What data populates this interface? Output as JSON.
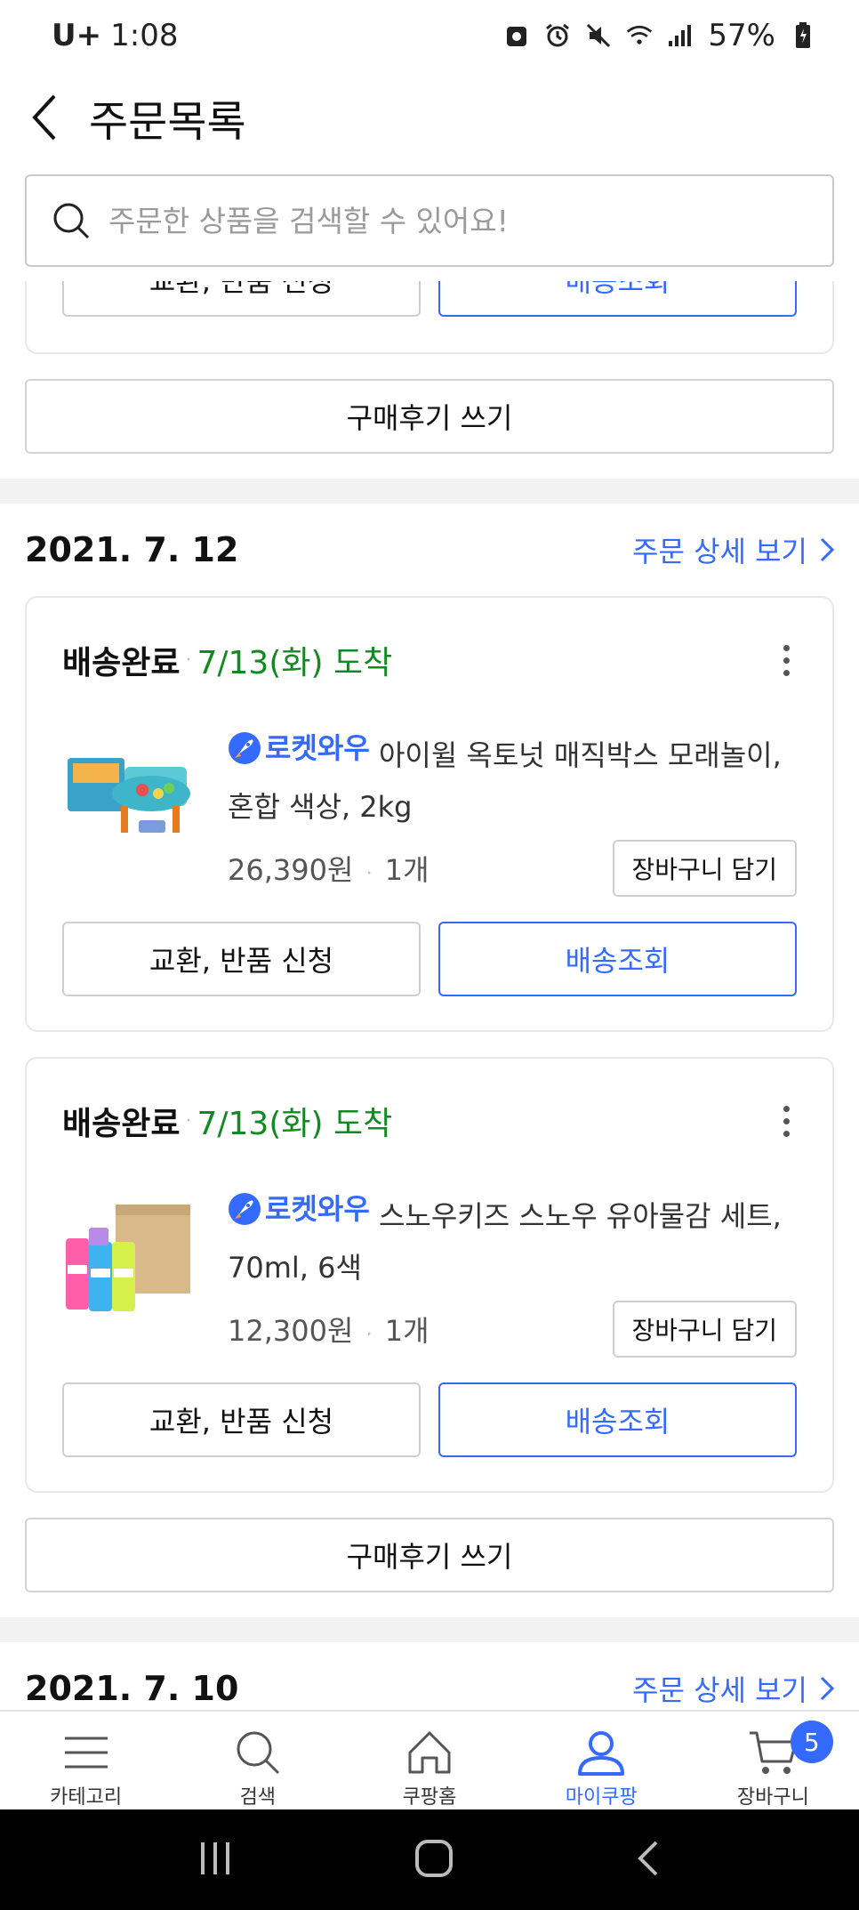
{
  "status_bar": {
    "carrier": "U+",
    "time": "1:08",
    "battery": "57%"
  },
  "header": {
    "title": "주문목록"
  },
  "search": {
    "placeholder": "주문한 상품을 검색할 수 있어요!"
  },
  "prev_order": {
    "exchange_label": "교환, 반품 신청",
    "tracking_label": "배송조회",
    "review_label": "구매후기 쓰기"
  },
  "orders": [
    {
      "date": "2021. 7. 12",
      "detail_link": "주문 상세 보기",
      "items": [
        {
          "status": "배송완료",
          "arrival": "7/13(화) 도착",
          "badge": "로켓와우",
          "name": "아이윌 옥토넛 매직박스 모래놀이, 혼합 색상, 2kg",
          "price": "26,390원",
          "qty": "1개",
          "cart_label": "장바구니 담기",
          "exchange_label": "교환, 반품 신청",
          "tracking_label": "배송조회"
        },
        {
          "status": "배송완료",
          "arrival": "7/13(화) 도착",
          "badge": "로켓와우",
          "name": "스노우키즈 스노우 유아물감 세트, 70ml, 6색",
          "price": "12,300원",
          "qty": "1개",
          "cart_label": "장바구니 담기",
          "exchange_label": "교환, 반품 신청",
          "tracking_label": "배송조회"
        }
      ],
      "review_label": "구매후기 쓰기"
    },
    {
      "date": "2021. 7. 10",
      "detail_link": "주문 상세 보기"
    }
  ],
  "bottom_nav": [
    {
      "label": "카테고리",
      "icon": "menu-icon"
    },
    {
      "label": "검색",
      "icon": "search-icon"
    },
    {
      "label": "쿠팡홈",
      "icon": "home-icon"
    },
    {
      "label": "마이쿠팡",
      "icon": "user-icon",
      "active": true
    },
    {
      "label": "장바구니",
      "icon": "cart-icon",
      "badge": "5"
    }
  ],
  "colors": {
    "accent": "#346aff",
    "arrival": "#118a22"
  }
}
